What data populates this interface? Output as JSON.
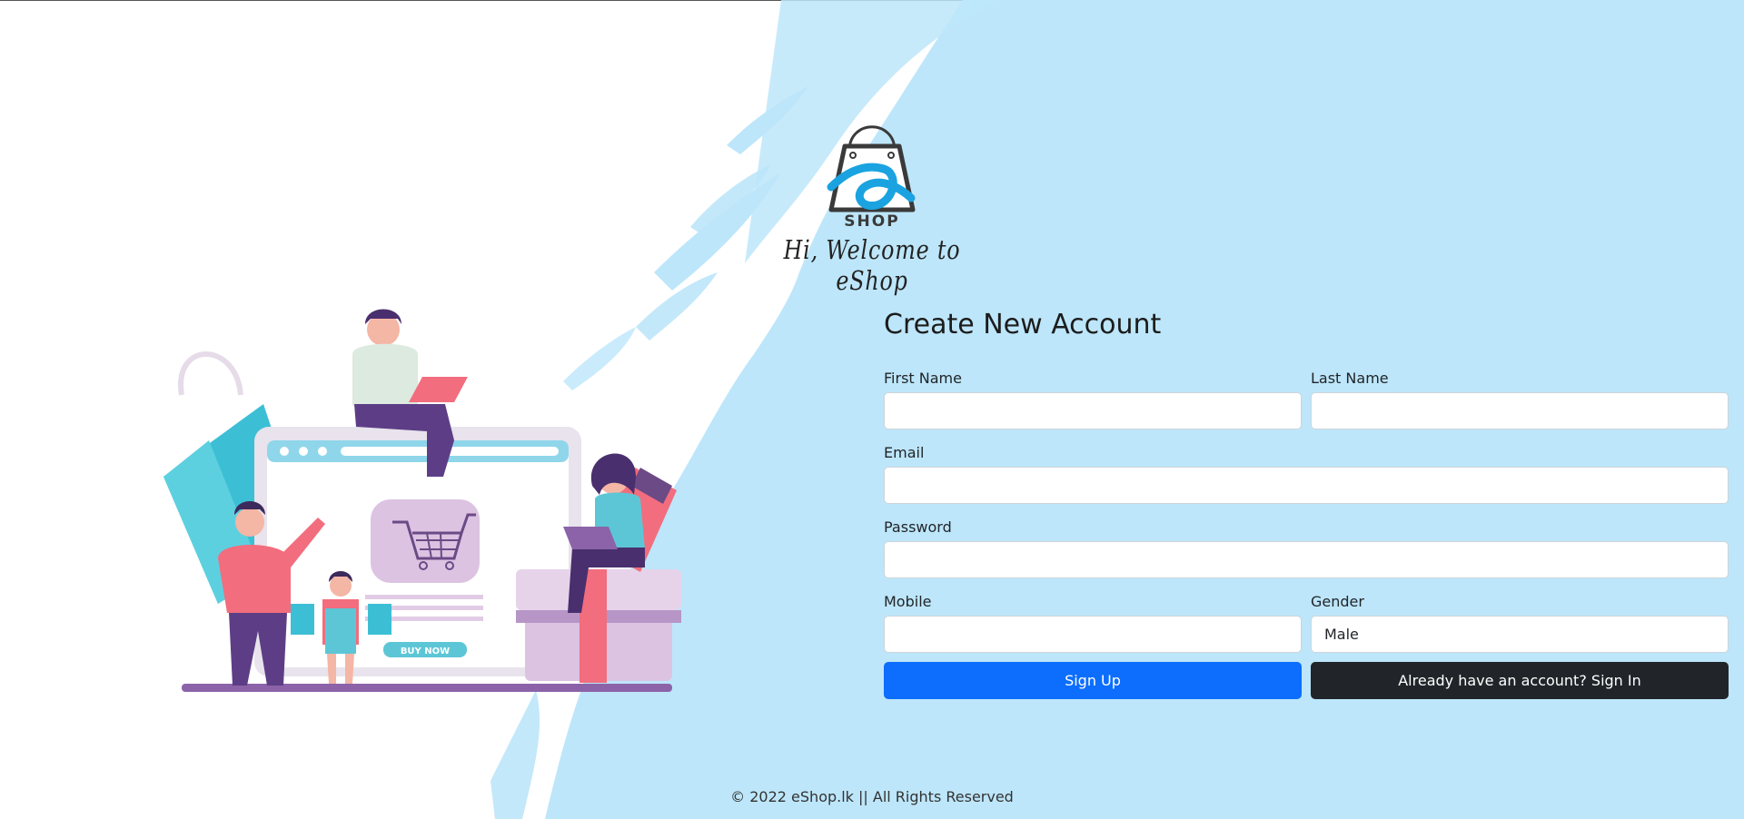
{
  "brand": {
    "logo_text": "SHOP",
    "welcome": "Hi, Welcome to eShop"
  },
  "form": {
    "title": "Create New Account",
    "first_name_label": "First Name",
    "last_name_label": "Last Name",
    "email_label": "Email",
    "password_label": "Password",
    "mobile_label": "Mobile",
    "gender_label": "Gender",
    "gender_value": "Male",
    "signup_label": "Sign Up",
    "signin_label": "Already have an account? Sign In"
  },
  "illustration": {
    "buy_now": "BUY NOW"
  },
  "footer": {
    "text": "© 2022 eShop.lk || All Rights Reserved"
  },
  "colors": {
    "splash": "#bde6fa",
    "primary": "#0d6efd",
    "dark": "#212529",
    "logo_blue": "#1aa3e0"
  }
}
